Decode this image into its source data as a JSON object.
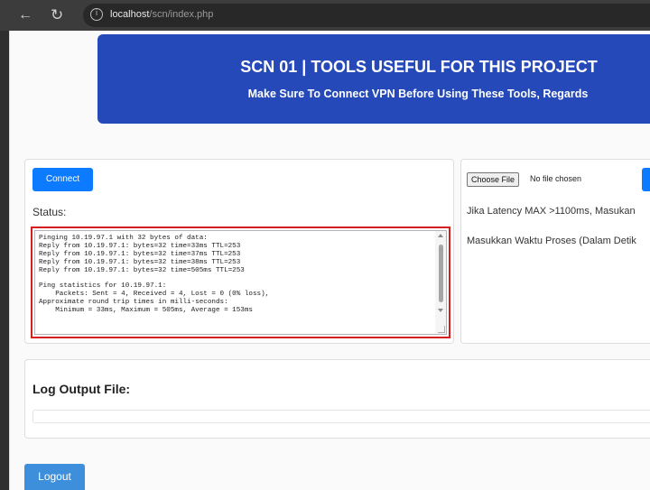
{
  "browser": {
    "back_icon": "arrow-left-icon",
    "reload_icon": "reload-icon",
    "info_icon": "info-icon",
    "url_host": "localhost",
    "url_path": "/scn/index.php"
  },
  "banner": {
    "title": "SCN 01 | TOOLS USEFUL FOR THIS PROJECT",
    "subtitle": "Make Sure To Connect VPN Before Using These Tools, Regards"
  },
  "left_panel": {
    "connect_label": "Connect",
    "status_label": "Status:",
    "output_lines": [
      "Pinging 10.19.97.1 with 32 bytes of data:",
      "Reply from 10.19.97.1: bytes=32 time=33ms TTL=253",
      "Reply from 10.19.97.1: bytes=32 time=37ms TTL=253",
      "Reply from 10.19.97.1: bytes=32 time=38ms TTL=253",
      "Reply from 10.19.97.1: bytes=32 time=505ms TTL=253",
      "",
      "Ping statistics for 10.19.97.1:",
      "    Packets: Sent = 4, Received = 4, Lost = 0 (0% loss),",
      "Approximate round trip times in milli-seconds:",
      "    Minimum = 33ms, Maximum = 505ms, Average = 153ms"
    ]
  },
  "right_panel": {
    "choose_file_label": "Choose File",
    "no_file_text": "No file chosen",
    "latency_text": "Jika Latency MAX >1100ms, Masukan",
    "process_text": "Masukkan Waktu Proses (Dalam Detik"
  },
  "log_panel": {
    "title": "Log Output File:"
  },
  "logout_label": "Logout",
  "colors": {
    "banner_bg": "#2549b8",
    "primary_button": "#0d7bff",
    "terminal_highlight_border": "#d62020"
  }
}
